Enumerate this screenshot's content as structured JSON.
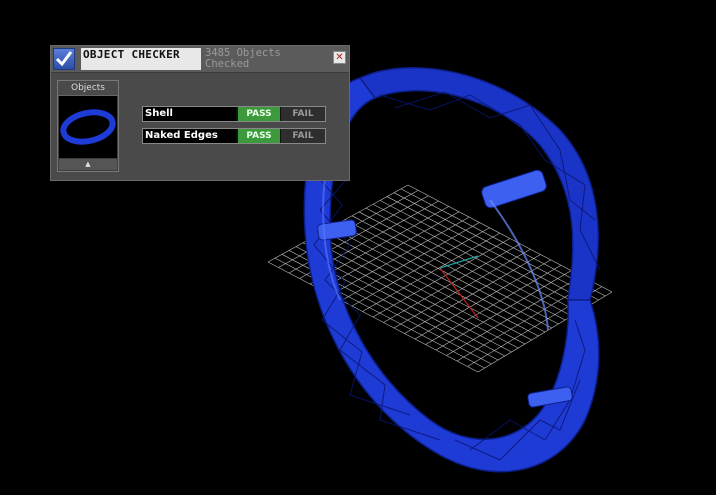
{
  "panel": {
    "title": "OBJECT CHECKER",
    "status": "3485 Objects Checked",
    "close_glyph": "✕",
    "icon": "checkmark-icon"
  },
  "objects": {
    "label": "Objects",
    "scroll_glyph": "▲"
  },
  "checks": [
    {
      "name": "Shell",
      "pass": "PASS",
      "fail": "FAIL",
      "result": "pass"
    },
    {
      "name": "Naked Edges",
      "pass": "PASS",
      "fail": "FAIL",
      "result": "pass"
    }
  ],
  "colors": {
    "model": "#1f3bd6",
    "pass": "#3c9a3c",
    "background": "#000000",
    "grid": "#cfcfcf",
    "axis_x": "#c22020",
    "axis_y": "#1e9e9e"
  }
}
